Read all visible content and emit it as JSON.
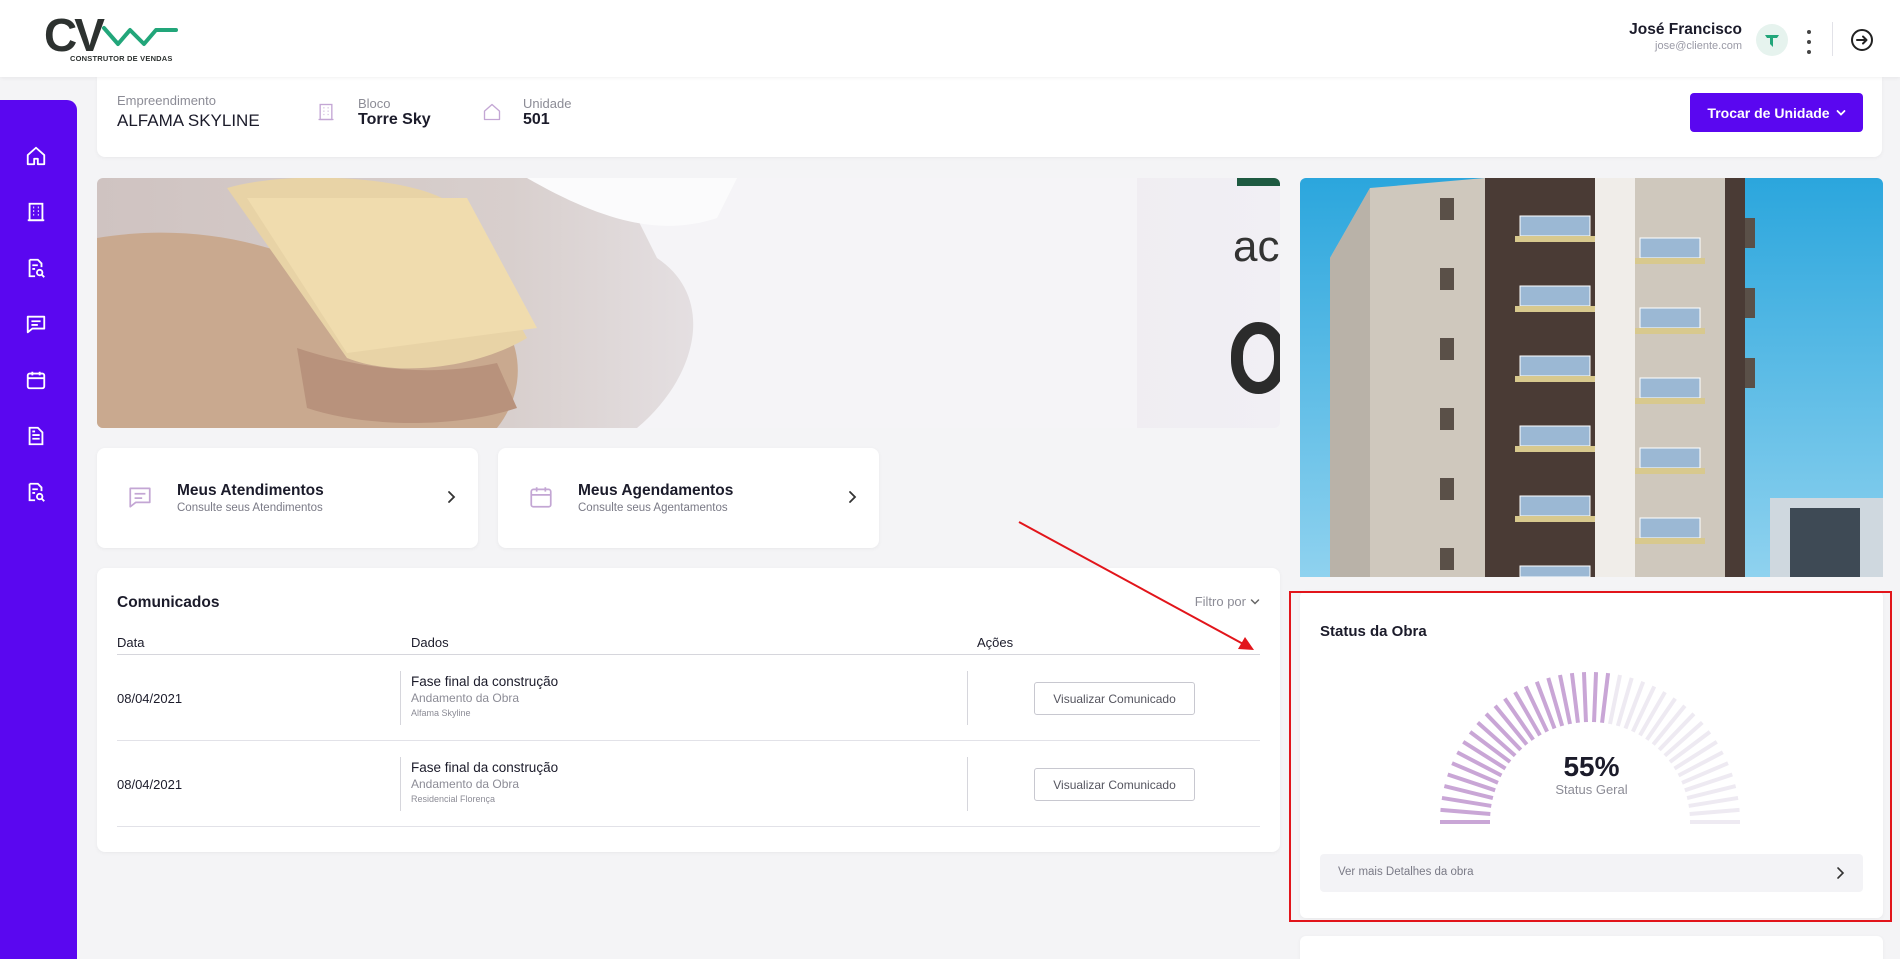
{
  "header": {
    "logo_text": "CV",
    "logo_sub": "CONSTRUTOR DE VENDAS",
    "user_name": "José Francisco",
    "user_email": "jose@cliente.com",
    "avatar_letter": "T",
    "menu_icon": "kebab-menu-icon",
    "logout_icon": "logout-icon"
  },
  "sidebar": {
    "color": "#5a07f0",
    "items": [
      {
        "icon": "home-icon"
      },
      {
        "icon": "building-icon"
      },
      {
        "icon": "document-search-icon"
      },
      {
        "icon": "chat-icon"
      },
      {
        "icon": "calendar-icon"
      },
      {
        "icon": "document-icon"
      },
      {
        "icon": "document-search-icon"
      }
    ]
  },
  "unit_bar": {
    "empreendimento_label": "Empreendimento",
    "empreendimento_value": "ALFAMA SKYLINE",
    "bloco_label": "Bloco",
    "bloco_value": "Torre Sky",
    "unidade_label": "Unidade",
    "unidade_value": "501",
    "trocar_label": "Trocar de Unidade"
  },
  "banner": {
    "partial_text": "ac"
  },
  "quick_cards": [
    {
      "title": "Meus Atendimentos",
      "subtitle": "Consulte seus Atendimentos",
      "icon": "chat-icon"
    },
    {
      "title": "Meus Agendamentos",
      "subtitle": "Consulte seus Agentamentos",
      "icon": "calendar-icon"
    }
  ],
  "comunicados": {
    "title": "Comunicados",
    "filter_label": "Filtro por",
    "columns": [
      "Data",
      "Dados",
      "Ações"
    ],
    "rows": [
      {
        "date": "08/04/2021",
        "title": "Fase final da construção",
        "category": "Andamento da Obra",
        "empreendimento": "Alfama Skyline",
        "action": "Visualizar Comunicado"
      },
      {
        "date": "08/04/2021",
        "title": "Fase final da construção",
        "category": "Andamento da Obra",
        "empreendimento": "Residencial Florença",
        "action": "Visualizar Comunicado"
      }
    ]
  },
  "status_obra": {
    "title": "Status da Obra",
    "percent": 55,
    "percent_label": "55%",
    "sublabel": "Status Geral",
    "details_label": "Ver mais Detalhes da obra"
  },
  "colors": {
    "accent": "#5a07f0",
    "gauge_filled": "#c9a6d6",
    "gauge_empty": "#eeeaf2",
    "annotation": "#e2151b"
  }
}
